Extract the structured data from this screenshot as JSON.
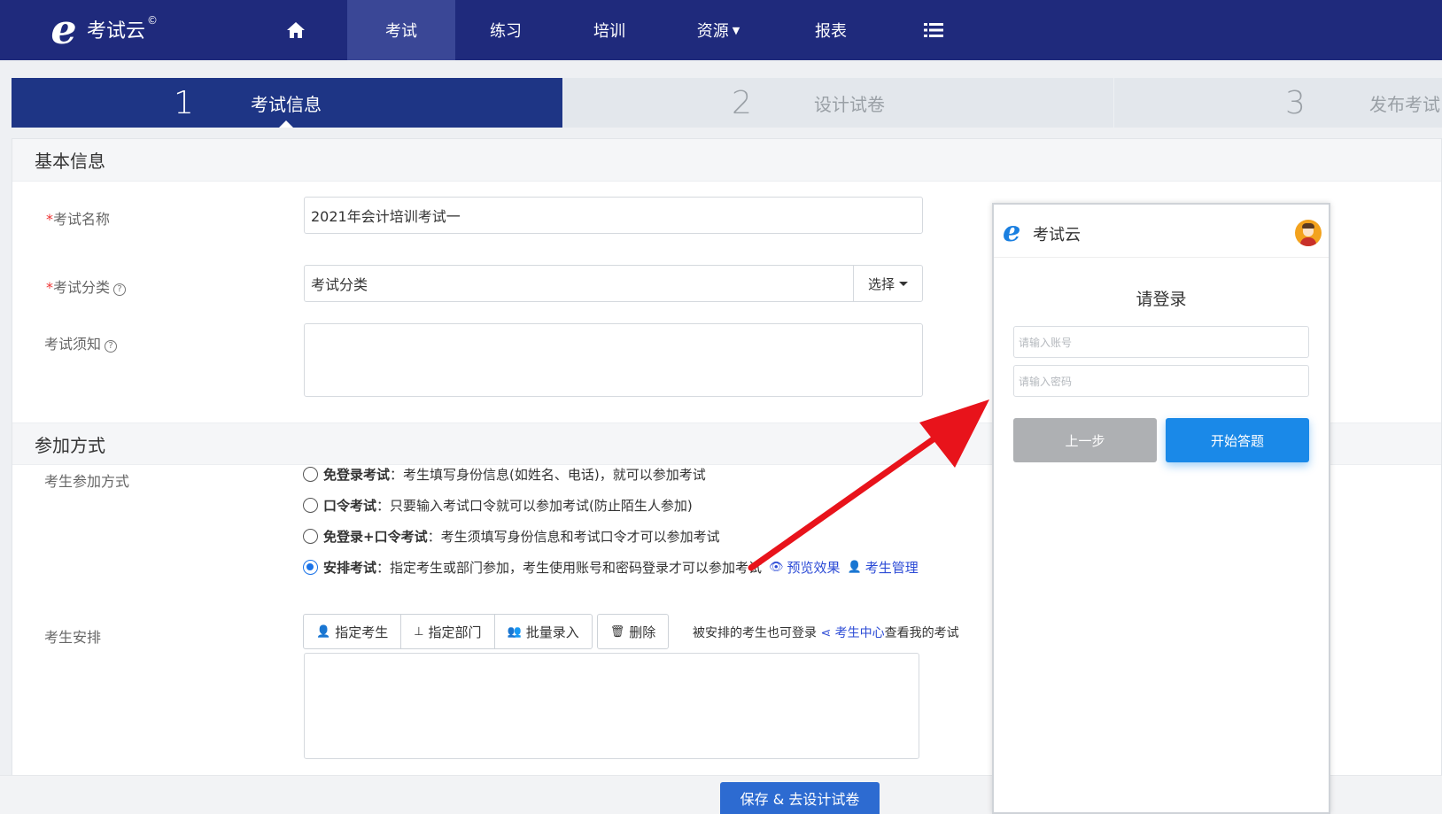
{
  "app": {
    "logo_text": "考试云",
    "logo_mark": "©"
  },
  "nav": {
    "home_icon": "home-icon",
    "items": [
      {
        "label": "考试"
      },
      {
        "label": "练习"
      },
      {
        "label": "培训"
      },
      {
        "label": "资源"
      },
      {
        "label": "报表"
      }
    ],
    "menu_icon": "list-icon"
  },
  "steps": [
    {
      "num": "1",
      "label": "考试信息"
    },
    {
      "num": "2",
      "label": "设计试卷"
    },
    {
      "num": "3",
      "label": "发布考试"
    }
  ],
  "basic": {
    "heading": "基本信息",
    "name_label": "考试名称",
    "name_value": "2021年会计培训考试一",
    "category_label": "考试分类",
    "category_value": "考试分类",
    "category_button": "选择",
    "notice_label": "考试须知"
  },
  "join": {
    "heading": "参加方式",
    "mode_label": "考生参加方式",
    "options": [
      {
        "title": "免登录考试",
        "desc": "：考生填写身份信息(如姓名、电话)，就可以参加考试"
      },
      {
        "title": "口令考试",
        "desc": "：只要输入考试口令就可以参加考试(防止陌生人参加)"
      },
      {
        "title": "免登录+口令考试",
        "desc": "：考生须填写身份信息和考试口令才可以参加考试"
      },
      {
        "title": "安排考试",
        "desc": "：指定考生或部门参加，考生使用账号和密码登录才可以参加考试"
      }
    ],
    "preview_link": "预览效果",
    "manage_link": "考生管理",
    "arrange_label": "考生安排",
    "buttons": {
      "assign_student": "指定考生",
      "assign_dept": "指定部门",
      "bulk_entry": "批量录入",
      "delete": "删除"
    },
    "note_prefix": "被安排的考生也可登录",
    "note_link": "考生中心",
    "note_suffix": "查看我的考试"
  },
  "footer": {
    "save_label": "保存 & 去设计试卷"
  },
  "phone": {
    "logo_text": "考试云",
    "title": "请登录",
    "account_placeholder": "请输入账号",
    "password_placeholder": "请输入密码",
    "prev_label": "上一步",
    "start_label": "开始答题"
  },
  "colors": {
    "nav_bg": "#1f2a7c",
    "step_active": "#1e3585",
    "accent_blue": "#1a89e8",
    "arrow_red": "#e8131b"
  }
}
